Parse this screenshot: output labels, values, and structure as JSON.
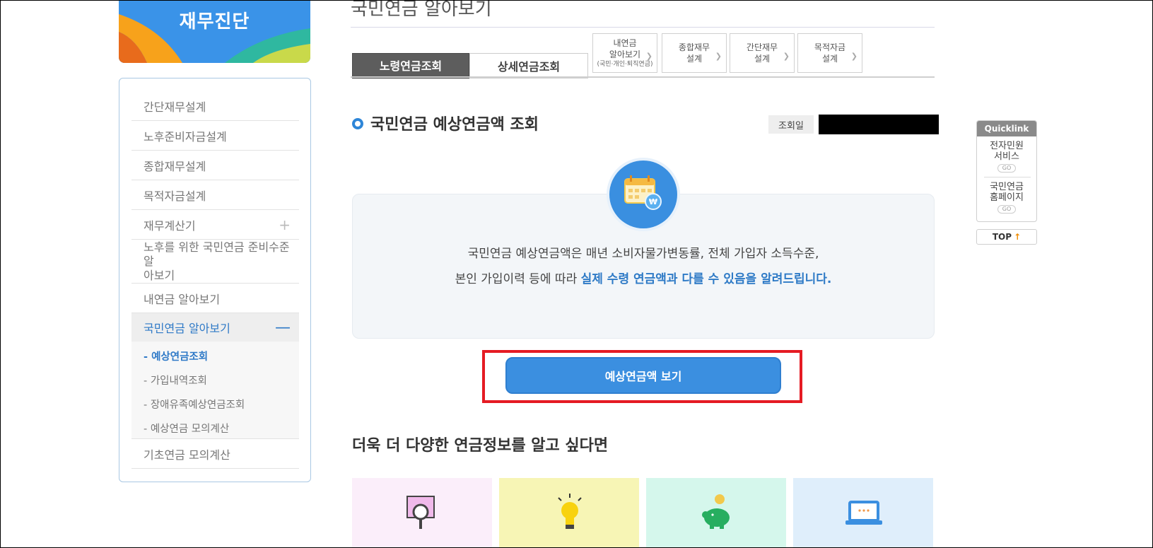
{
  "banner": {
    "title": "재무진단"
  },
  "sidenav": {
    "items": [
      {
        "label": "간단재무설계"
      },
      {
        "label": "노후준비자금설계"
      },
      {
        "label": "종합재무설계"
      },
      {
        "label": "목적자금설계"
      },
      {
        "label": "재무계산기",
        "expand": "+"
      },
      {
        "label_line1": "노후를 위한 국민연금 준비수준 알",
        "label_line2": "아보기"
      },
      {
        "label": "내연금 알아보기"
      },
      {
        "label": "국민연금 알아보기",
        "collapse": "—"
      },
      {
        "label": "기초연금 모의계산"
      }
    ],
    "subitems": [
      {
        "label": "- 예상연금조회"
      },
      {
        "label": "- 가입내역조회"
      },
      {
        "label": "- 장애유족예상연금조회"
      },
      {
        "label": "- 예상연금 모의계산"
      }
    ]
  },
  "header": {
    "title": "국민연금 알아보기",
    "tabs": [
      {
        "label": "노령연금조회"
      },
      {
        "label": "상세연금조회"
      }
    ],
    "quick_buttons": [
      {
        "line1": "내연금",
        "line2": "알아보기",
        "line3": "(국민·개인·퇴직연금)"
      },
      {
        "line1": "종합재무",
        "line2": "설계"
      },
      {
        "line1": "간단재무",
        "line2": "설계"
      },
      {
        "line1": "목적자금",
        "line2": "설계"
      }
    ]
  },
  "section": {
    "title": "국민연금 예상연금액 조회",
    "date_label": "조회일",
    "date_value": ""
  },
  "info": {
    "line1": "국민연금 예상연금액은 매년 소비자물가변동률, 전체 가입자 소득수준,",
    "line2_plain": "본인 가입이력 등에 따라 ",
    "line2_highlight": "실제 수령 연금액과 다를 수 있음을 알려드립니다."
  },
  "primary_button": {
    "label": "예상연금액 보기"
  },
  "more": {
    "title": "더욱 더 다양한 연금정보를 알고 싶다면"
  },
  "quicklink": {
    "title": "Quicklink",
    "items": [
      {
        "line1": "전자민원",
        "line2": "서비스",
        "go": "GO"
      },
      {
        "line1": "국민연금",
        "line2": "홈페이지",
        "go": "GO"
      }
    ],
    "top_label": "TOP",
    "top_arrow": "↑"
  },
  "colors": {
    "accent": "#3b8fe0",
    "highlight_border": "#e51b23",
    "active_nav_text": "#2e79c7"
  }
}
